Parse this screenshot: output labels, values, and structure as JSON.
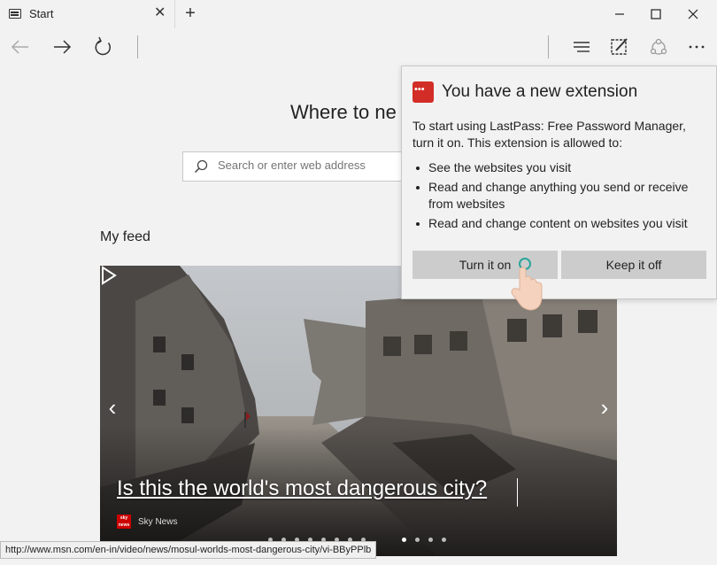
{
  "tab": {
    "title": "Start",
    "icon": "browser-tab-icon"
  },
  "window_controls": {
    "minimize": "minimize-icon",
    "maximize": "maximize-icon",
    "close": "close-icon"
  },
  "page": {
    "heading": "Where to ne"
  },
  "search": {
    "placeholder": "Search or enter web address"
  },
  "feed": {
    "label": "My feed",
    "headline": "Is this the world's most dangerous city?",
    "source": "Sky News",
    "source_logo": "sky news",
    "dots_total": 11,
    "active_dot": 8
  },
  "status_url": "http://www.msn.com/en-in/video/news/mosul-worlds-most-dangerous-city/vi-BByPPlb",
  "popup": {
    "title": "You have a new extension",
    "description": "To start using LastPass: Free Password Manager, turn it on. This extension is allowed to:",
    "permissions": [
      "See the websites you visit",
      "Read and change anything you send or receive from websites",
      "Read and change content on websites you visit"
    ],
    "turn_on_label": "Turn it on",
    "keep_off_label": "Keep it off",
    "accent_color": "#d32d27"
  }
}
